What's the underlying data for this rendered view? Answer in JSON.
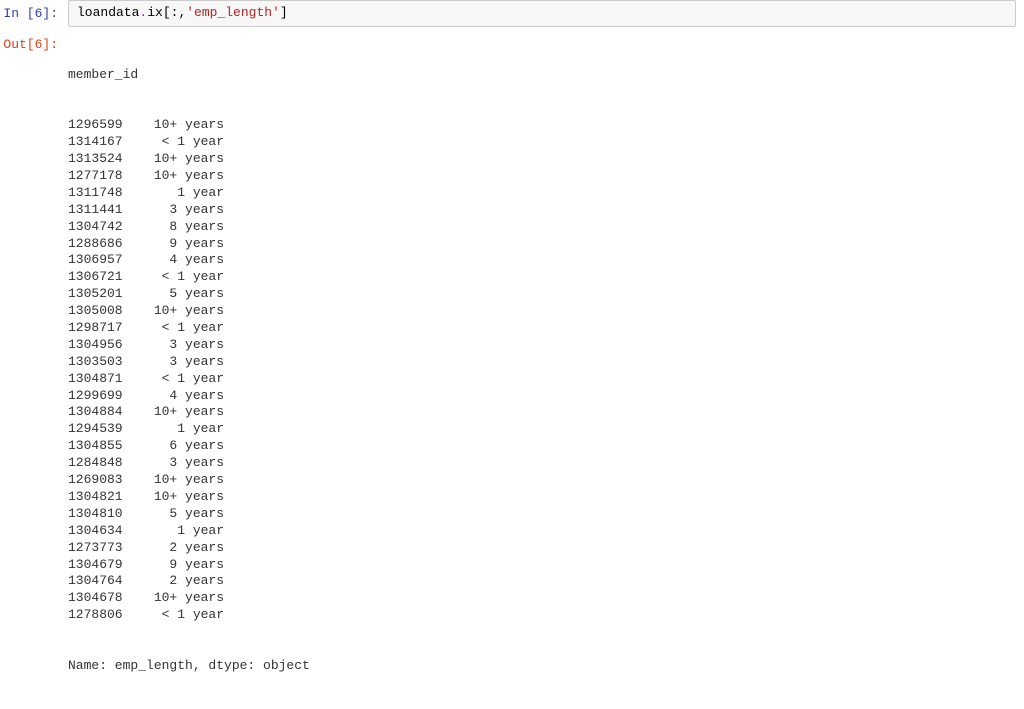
{
  "input": {
    "prompt": "In  [6]:",
    "code_var": "loandata",
    "code_dot": ".",
    "code_method": "ix",
    "code_open": "[:,",
    "code_string": "'emp_length'",
    "code_close": "]"
  },
  "output": {
    "prompt": "Out[6]:",
    "header": "member_id",
    "rows": [
      {
        "id": "1296599",
        "val": "10+ years"
      },
      {
        "id": "1314167",
        "val": "< 1 year"
      },
      {
        "id": "1313524",
        "val": "10+ years"
      },
      {
        "id": "1277178",
        "val": "10+ years"
      },
      {
        "id": "1311748",
        "val": "1 year"
      },
      {
        "id": "1311441",
        "val": "3 years"
      },
      {
        "id": "1304742",
        "val": "8 years"
      },
      {
        "id": "1288686",
        "val": "9 years"
      },
      {
        "id": "1306957",
        "val": "4 years"
      },
      {
        "id": "1306721",
        "val": "< 1 year"
      },
      {
        "id": "1305201",
        "val": "5 years"
      },
      {
        "id": "1305008",
        "val": "10+ years"
      },
      {
        "id": "1298717",
        "val": "< 1 year"
      },
      {
        "id": "1304956",
        "val": "3 years"
      },
      {
        "id": "1303503",
        "val": "3 years"
      },
      {
        "id": "1304871",
        "val": "< 1 year"
      },
      {
        "id": "1299699",
        "val": "4 years"
      },
      {
        "id": "1304884",
        "val": "10+ years"
      },
      {
        "id": "1294539",
        "val": "1 year"
      },
      {
        "id": "1304855",
        "val": "6 years"
      },
      {
        "id": "1284848",
        "val": "3 years"
      },
      {
        "id": "1269083",
        "val": "10+ years"
      },
      {
        "id": "1304821",
        "val": "10+ years"
      },
      {
        "id": "1304810",
        "val": "5 years"
      },
      {
        "id": "1304634",
        "val": "1 year"
      },
      {
        "id": "1273773",
        "val": "2 years"
      },
      {
        "id": "1304679",
        "val": "9 years"
      },
      {
        "id": "1304764",
        "val": "2 years"
      },
      {
        "id": "1304678",
        "val": "10+ years"
      },
      {
        "id": "1278806",
        "val": "< 1 year"
      }
    ],
    "footer": "Name: emp_length, dtype: object"
  }
}
